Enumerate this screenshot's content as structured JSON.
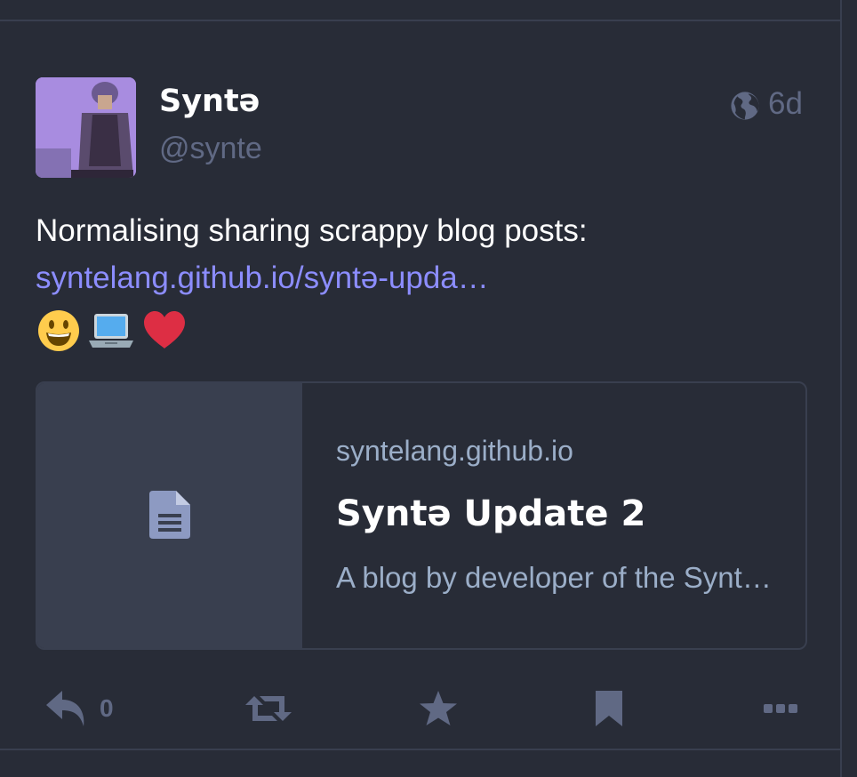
{
  "status": {
    "display_name": "Syntə",
    "username": "@synte",
    "visibility_icon": "globe-icon",
    "relative_time": "6d",
    "content_text": "Normalising sharing scrappy blog posts:",
    "content_link": "syntelang.github.io/syntə-upda…",
    "emojis": [
      "😃",
      "💻",
      "❤️"
    ]
  },
  "card": {
    "thumbnail_icon": "document-icon",
    "host": "syntelang.github.io",
    "title": "Syntə Update 2",
    "description": "A blog by developer of the Syntə programming language"
  },
  "actions": {
    "reply_icon": "reply-icon",
    "reply_count": "0",
    "boost_icon": "boost-icon",
    "favourite_icon": "star-icon",
    "bookmark_icon": "bookmark-icon",
    "more_icon": "ellipsis-icon"
  },
  "colors": {
    "background": "#282c37",
    "border": "#393f4f",
    "link": "#8c8dff",
    "muted": "#606984",
    "secondary_text": "#9baec8"
  }
}
